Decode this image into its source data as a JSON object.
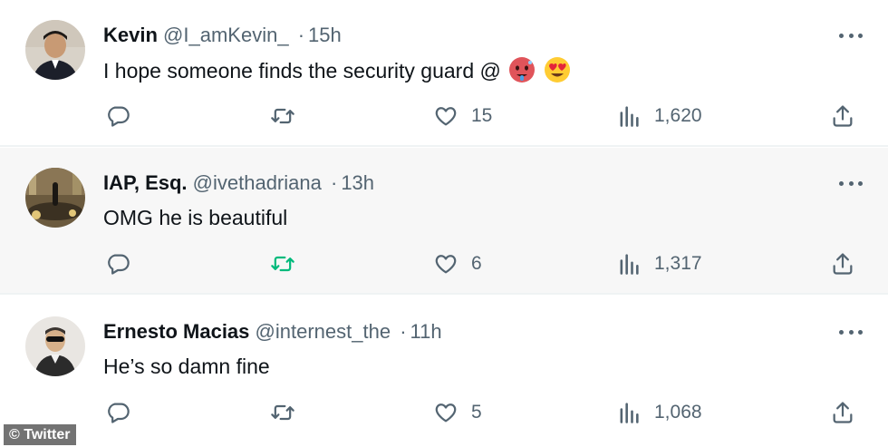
{
  "tweets": [
    {
      "name": "Kevin",
      "handle": "@I_amKevin_",
      "separator": "·",
      "time": "15h",
      "text": "I hope someone finds the security guard @",
      "emojis": [
        "hot-face-emoji",
        "heart-eyes-emoji"
      ],
      "replies": "",
      "retweets": "",
      "likes": "15",
      "views": "1,620"
    },
    {
      "name": "IAP, Esq.",
      "handle": "@ivethadriana",
      "separator": "·",
      "time": "13h",
      "text": "OMG he is beautiful",
      "replies": "",
      "retweets": "",
      "likes": "6",
      "views": "1,317"
    },
    {
      "name": "Ernesto Macias",
      "handle": "@internest_the",
      "separator": "·",
      "time": "11h",
      "text": "He’s so damn fine",
      "replies": "",
      "retweets": "",
      "likes": "5",
      "views": "1,068"
    }
  ],
  "watermark": "© Twitter",
  "colors": {
    "text": "#0f1419",
    "secondary": "#536471",
    "highlight_bg": "#f7f7f7",
    "retweet_highlight": "#00ba7c",
    "divider": "#eff3f4"
  },
  "icons": [
    "reply-icon",
    "retweet-icon",
    "like-icon",
    "views-icon",
    "share-icon",
    "more-icon"
  ]
}
